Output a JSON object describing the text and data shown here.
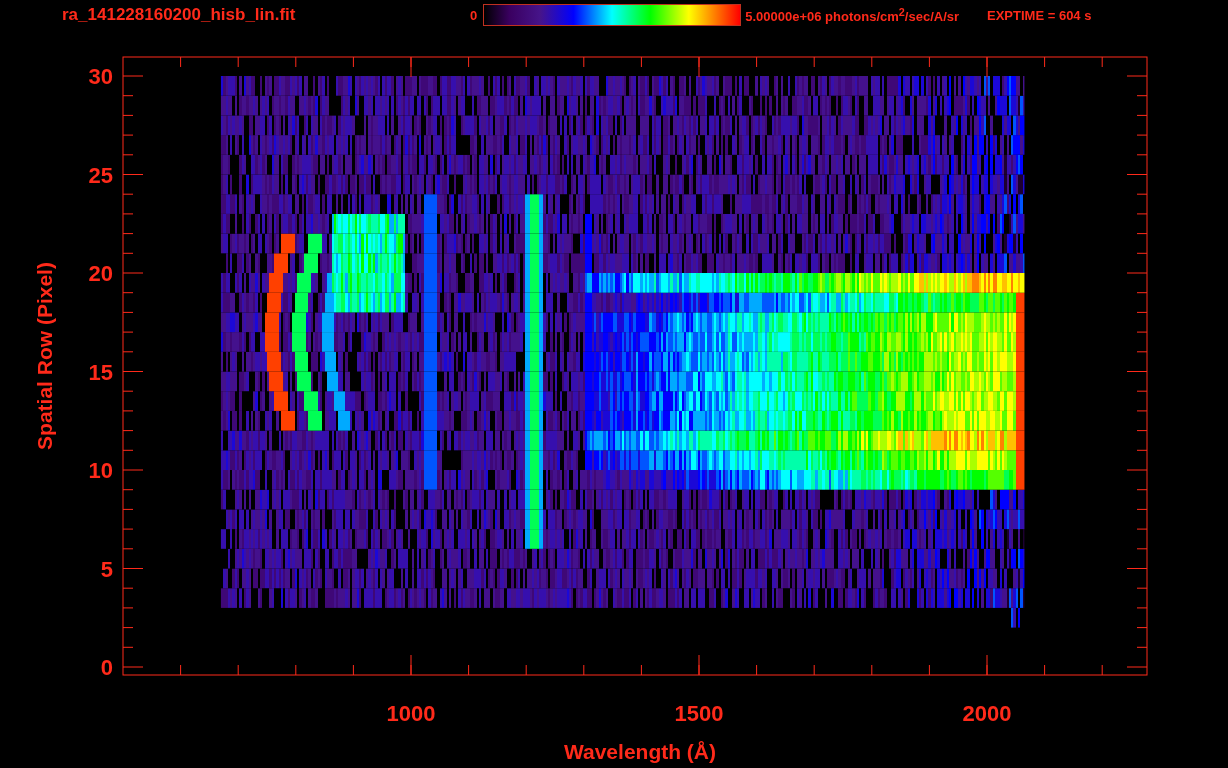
{
  "title": "ra_141228160200_hisb_lin.fit",
  "colorbar": {
    "min_label": "0",
    "max_label": "5.00000e+06 photons/cm$^{2}$/sec/A/sr"
  },
  "exposure": "EXPTIME = 604 s",
  "plot": {
    "xlabel": "Wavelength (Å)",
    "ylabel": "Spatial Row (Pixel)",
    "xtick_labels": [
      "1000",
      "1500",
      "2000"
    ],
    "ytick_labels": [
      "30",
      "25",
      "20",
      "15",
      "10",
      "5",
      "0"
    ]
  }
}
